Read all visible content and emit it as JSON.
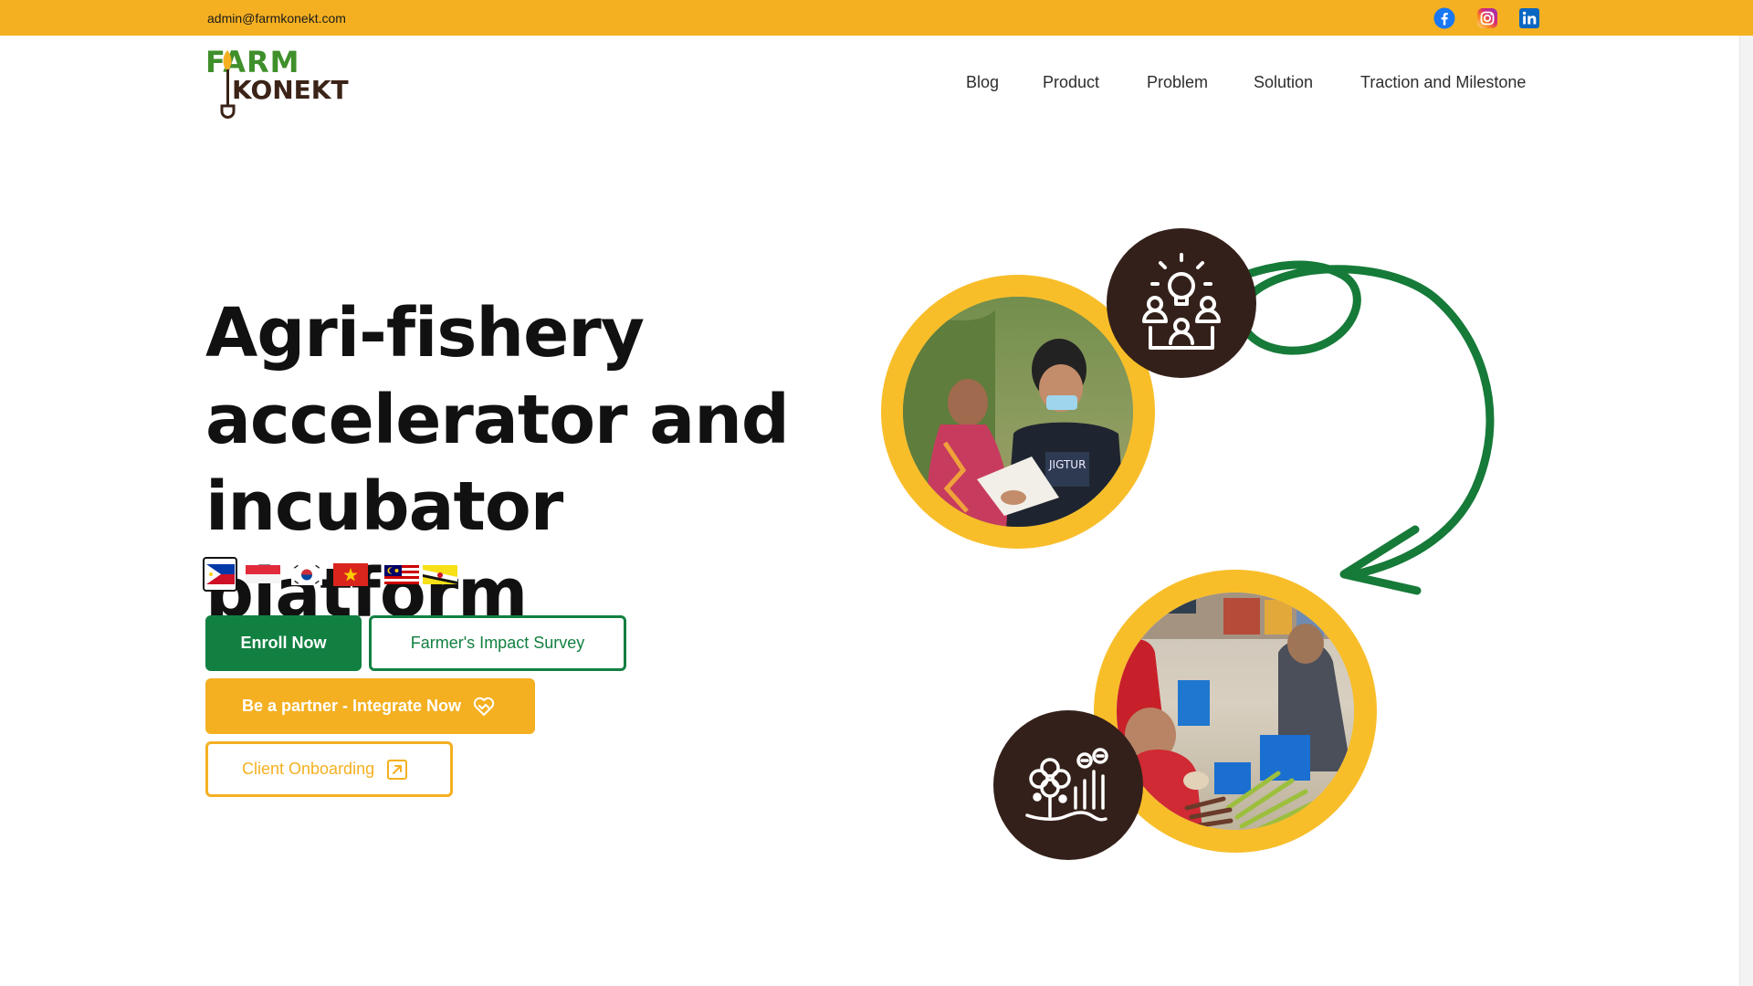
{
  "topbar": {
    "email": "admin@farmkonekt.com",
    "social": [
      "facebook-icon",
      "instagram-icon",
      "linkedin-icon"
    ]
  },
  "logo": {
    "line1": "FARM",
    "line2": "KONEKT"
  },
  "nav": {
    "items": [
      {
        "label": "Blog"
      },
      {
        "label": "Product"
      },
      {
        "label": "Problem"
      },
      {
        "label": "Solution"
      },
      {
        "label": "Traction and Milestone"
      }
    ]
  },
  "hero": {
    "title_line1": "Agri-fishery",
    "title_line2": "accelerator and",
    "title_line3": "incubator platform",
    "flags": [
      "philippines-flag",
      "indonesia-flag",
      "south-korea-flag",
      "vietnam-flag",
      "malaysia-flag",
      "brunei-flag"
    ],
    "selected_flag": "philippines-flag"
  },
  "buttons": {
    "enroll": "Enroll Now",
    "survey": "Farmer's Impact Survey",
    "partner": "Be a partner - Integrate Now",
    "client": "Client Onboarding"
  },
  "colors": {
    "brand_yellow": "#f4b021",
    "brand_green": "#128041",
    "dark_brown": "#34201a",
    "arrow_green": "#167a38"
  }
}
